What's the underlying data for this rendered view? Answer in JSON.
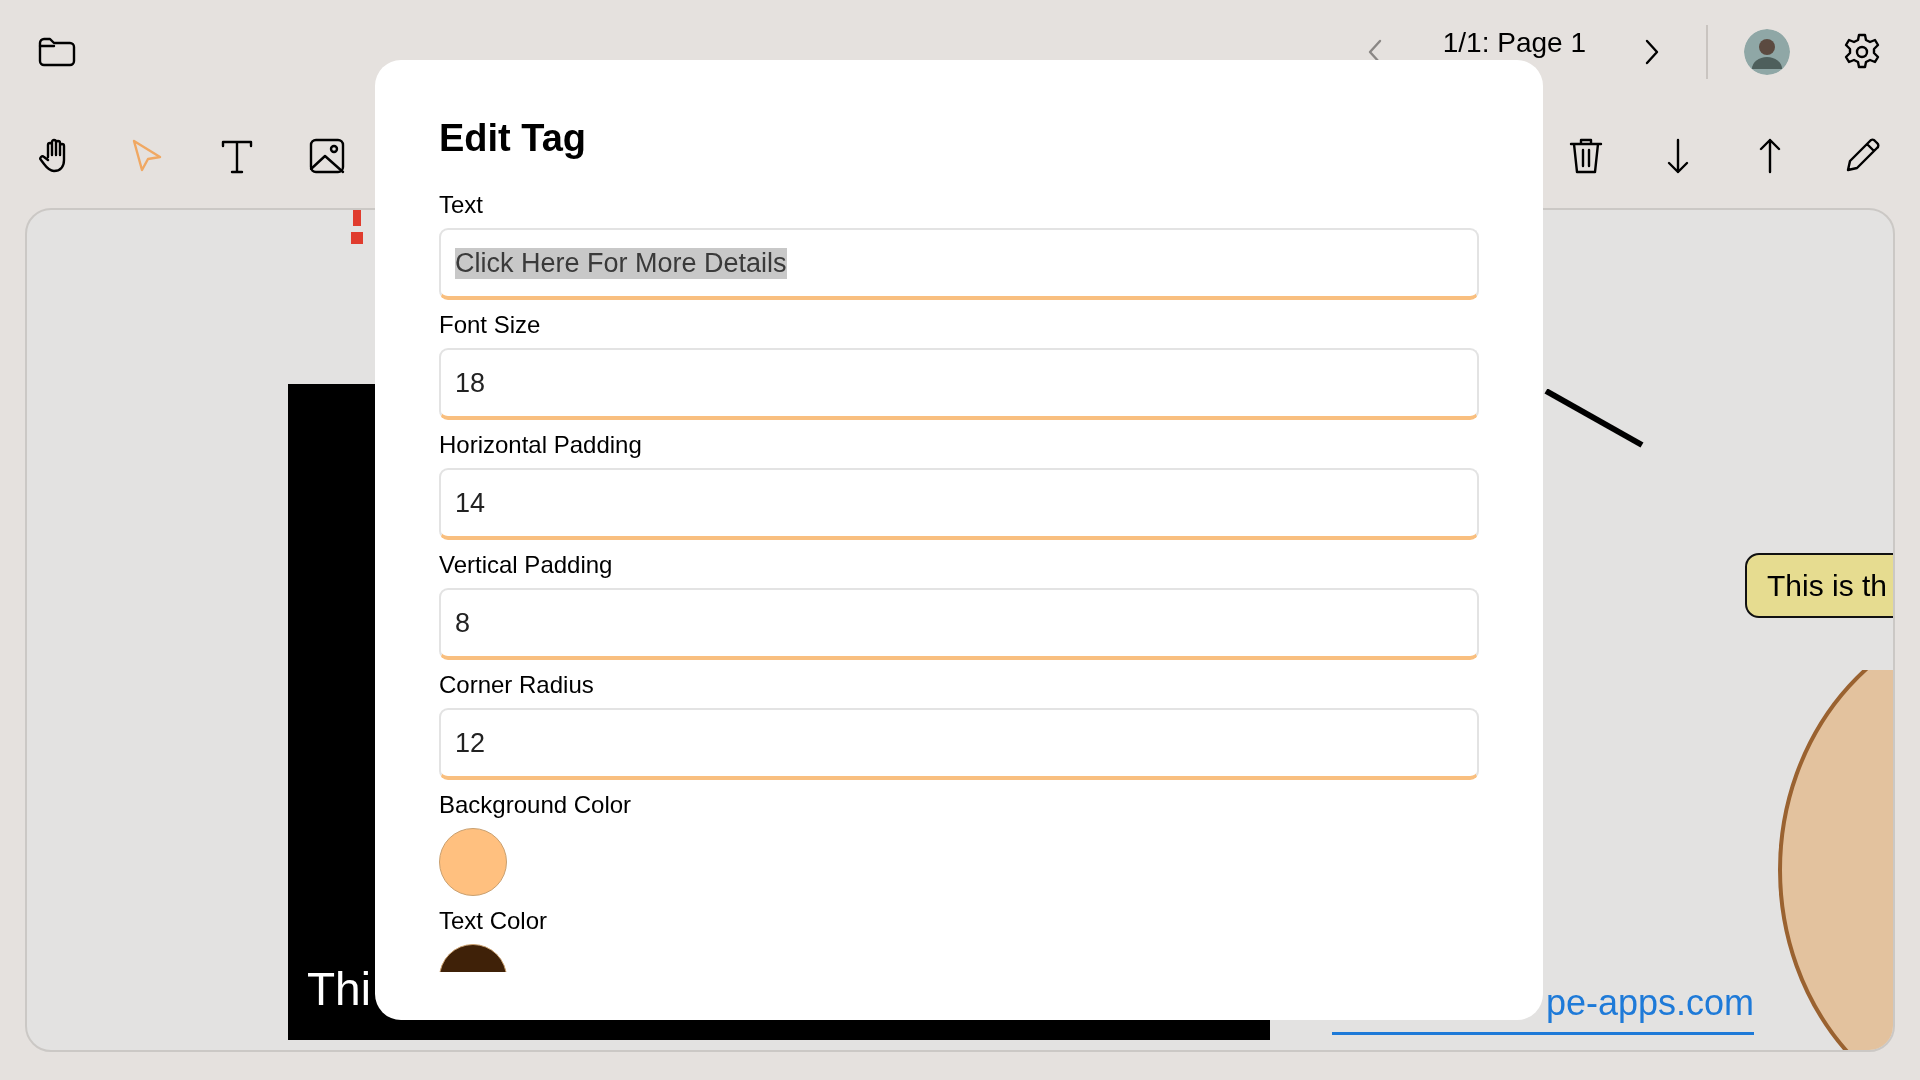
{
  "top_bar": {
    "page_nav": {
      "prev_disabled": true,
      "label": "1/1: Page 1",
      "next_disabled": false
    }
  },
  "toolbar": {
    "tools": [
      {
        "kind": "hand",
        "selected": false
      },
      {
        "kind": "pointer",
        "selected": true
      },
      {
        "kind": "text",
        "selected": false
      },
      {
        "kind": "image",
        "selected": false
      }
    ],
    "actions": [
      {
        "kind": "delete"
      },
      {
        "kind": "move-down"
      },
      {
        "kind": "move-up"
      },
      {
        "kind": "edit"
      }
    ]
  },
  "canvas": {
    "items": [
      {
        "kind": "marker"
      },
      {
        "kind": "text_block",
        "text": "Thi"
      },
      {
        "kind": "line"
      },
      {
        "kind": "tag",
        "text": "This is th",
        "color": "#e6dc90"
      },
      {
        "kind": "ellipse",
        "color": "#e3c29e"
      },
      {
        "kind": "link",
        "text": "pe-apps.com"
      }
    ]
  },
  "dialog": {
    "title": "Edit Tag",
    "fields": [
      {
        "kind": "text",
        "label": "Text",
        "value": "Click Here For More Details",
        "text_selected": true
      },
      {
        "kind": "text",
        "label": "Font Size",
        "value": "18",
        "text_selected": false
      },
      {
        "kind": "text",
        "label": "Horizontal Padding",
        "value": "14",
        "text_selected": false
      },
      {
        "kind": "text",
        "label": "Vertical Padding",
        "value": "8",
        "text_selected": false
      },
      {
        "kind": "text",
        "label": "Corner Radius",
        "value": "12",
        "text_selected": false
      },
      {
        "kind": "color",
        "label": "Background Color",
        "color": "#ffc07f"
      },
      {
        "kind": "color",
        "label": "Text Color",
        "color": "#3f2108"
      }
    ]
  }
}
